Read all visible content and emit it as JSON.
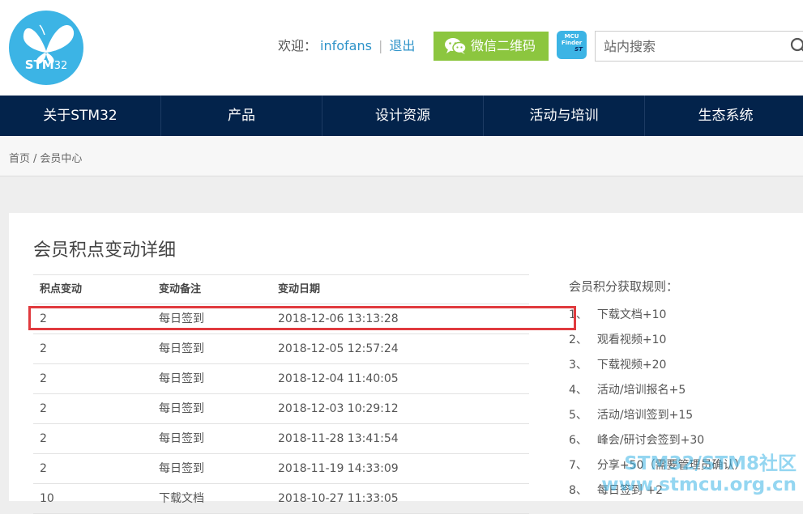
{
  "header": {
    "logo_text": "STM",
    "logo_sub": "32",
    "welcome_label": "欢迎：",
    "username": "infofans",
    "separator": "|",
    "logout": "退出",
    "wechat_button": "微信二维码",
    "mcu_badge_line1": "MCU",
    "mcu_badge_line2": "Finder",
    "mcu_badge_line3": "ST",
    "search": {
      "placeholder": "站内搜索",
      "value": ""
    }
  },
  "nav": {
    "items": [
      {
        "label": "关于STM32"
      },
      {
        "label": "产品"
      },
      {
        "label": "设计资源"
      },
      {
        "label": "活动与培训"
      },
      {
        "label": "生态系统"
      }
    ]
  },
  "breadcrumb": {
    "home": "首页",
    "divider": "/",
    "current": "会员中心"
  },
  "main": {
    "title": "会员积点变动详细",
    "table": {
      "headers": [
        "积点变动",
        "变动备注",
        "变动日期"
      ],
      "rows": [
        [
          "2",
          "每日签到",
          "2018-12-06 13:13:28"
        ],
        [
          "2",
          "每日签到",
          "2018-12-05 12:57:24"
        ],
        [
          "2",
          "每日签到",
          "2018-12-04 11:40:05"
        ],
        [
          "2",
          "每日签到",
          "2018-12-03 10:29:12"
        ],
        [
          "2",
          "每日签到",
          "2018-11-28 13:41:54"
        ],
        [
          "2",
          "每日签到",
          "2018-11-19 14:33:09"
        ],
        [
          "10",
          "下载文档",
          "2018-10-27 11:33:05"
        ]
      ]
    },
    "rules": {
      "title": "会员积分获取规则：",
      "items": [
        {
          "index": "1、",
          "text": "下载文档+10"
        },
        {
          "index": "2、",
          "text": "观看视频+10"
        },
        {
          "index": "3、",
          "text": "下载视频+20"
        },
        {
          "index": "4、",
          "text": "活动/培训报名+5"
        },
        {
          "index": "5、",
          "text": "活动/培训签到+15"
        },
        {
          "index": "6、",
          "text": "峰会/研讨会签到+30"
        },
        {
          "index": "7、",
          "text": "分享+50（需要管理员确认）"
        },
        {
          "index": "8、",
          "text": "每日签到 +2"
        }
      ]
    }
  },
  "watermark": {
    "line1": "STM32/STM8社区",
    "line2": "www.stmcu.org.cn"
  },
  "colors": {
    "brand_blue": "#3cb4e5",
    "nav_navy": "#03234b",
    "wechat_green": "#8cc63f",
    "highlight_red": "#e03a3e",
    "link_blue": "#2e93c9"
  },
  "icons": {
    "logo": "butterfly-logo-icon",
    "wechat": "wechat-icon",
    "search": "search-icon"
  }
}
